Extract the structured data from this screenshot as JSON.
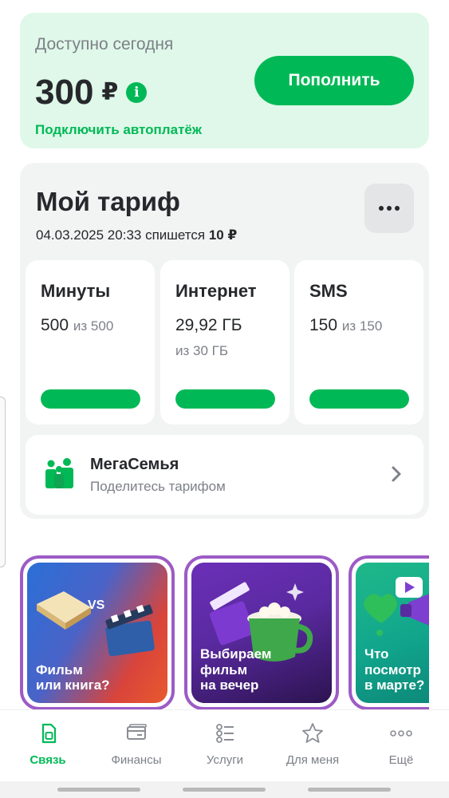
{
  "balance": {
    "caption": "Доступно сегодня",
    "amount": "300",
    "currency": "₽",
    "info_icon": "info-icon",
    "autopay_link": "Подключить автоплатёж",
    "topup_button": "Пополнить"
  },
  "tariff": {
    "title": "Мой тариф",
    "charge_date": "04.03.2025 20:33 спишется",
    "charge_amount": "10 ₽",
    "more_icon": "more-horizontal-icon",
    "quotas": [
      {
        "title": "Минуты",
        "value": "500",
        "of": "из 500",
        "sub": "",
        "fill": 1.0
      },
      {
        "title": "Интернет",
        "value": "29,92 ГБ",
        "of": "",
        "sub": "из 30 ГБ",
        "fill": 0.997
      },
      {
        "title": "SMS",
        "value": "150",
        "of": "из 150",
        "sub": "",
        "fill": 1.0
      }
    ],
    "family": {
      "title": "МегаСемья",
      "subtitle": "Поделитесь тарифом",
      "icon": "family-icon"
    }
  },
  "stories": [
    {
      "label": "Фильм\nили книга?",
      "badge": "VS"
    },
    {
      "label": "Выбираем\nфильм\nна вечер"
    },
    {
      "label": "Что\nпосмотр\nв марте?"
    }
  ],
  "bottom_nav": [
    {
      "label": "Связь",
      "icon": "sim-card-icon",
      "active": true
    },
    {
      "label": "Финансы",
      "icon": "card-icon",
      "active": false
    },
    {
      "label": "Услуги",
      "icon": "services-icon",
      "active": false
    },
    {
      "label": "Для меня",
      "icon": "star-icon",
      "active": false
    },
    {
      "label": "Ещё",
      "icon": "more-dots-icon",
      "active": false
    }
  ],
  "colors": {
    "accent": "#00b956",
    "balance_bg": "#dff8e9",
    "story_border": "#9d5bc6",
    "text_primary": "#26282b",
    "text_secondary": "#7d8088"
  }
}
